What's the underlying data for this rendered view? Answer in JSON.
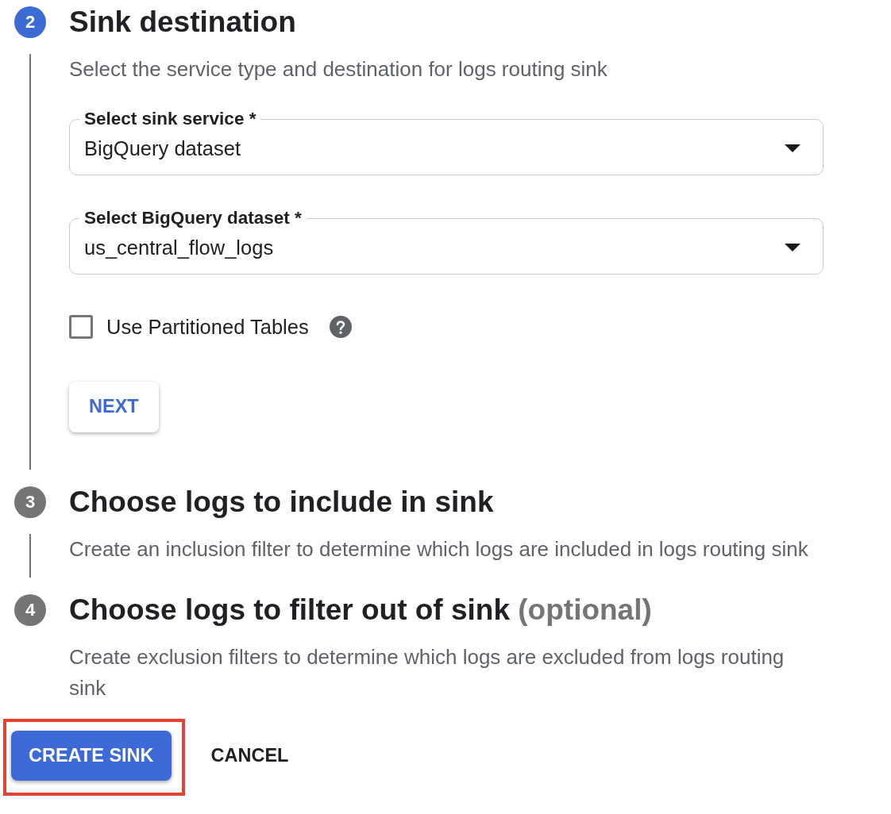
{
  "steps": [
    {
      "number": "2",
      "active": true,
      "title": "Sink destination",
      "description": "Select the service type and destination for logs routing sink",
      "fields": [
        {
          "kind": "select",
          "label": "Select sink service *",
          "value": "BigQuery dataset"
        },
        {
          "kind": "select",
          "label": "Select BigQuery dataset *",
          "value": "us_central_flow_logs"
        },
        {
          "kind": "checkbox",
          "label": "Use Partitioned Tables",
          "checked": false,
          "help": true
        }
      ],
      "next_button": "NEXT"
    },
    {
      "number": "3",
      "active": false,
      "title": "Choose logs to include in sink",
      "description": "Create an inclusion filter to determine which logs are included in logs routing sink"
    },
    {
      "number": "4",
      "active": false,
      "title": "Choose logs to filter out of sink",
      "note": "(optional)",
      "description": "Create exclusion filters to determine which logs are excluded from logs routing sink"
    }
  ],
  "actions": [
    {
      "kind": "raised",
      "label": "CREATE SINK",
      "highlighted": true
    },
    {
      "kind": "text",
      "label": "CANCEL",
      "highlighted": false
    }
  ]
}
